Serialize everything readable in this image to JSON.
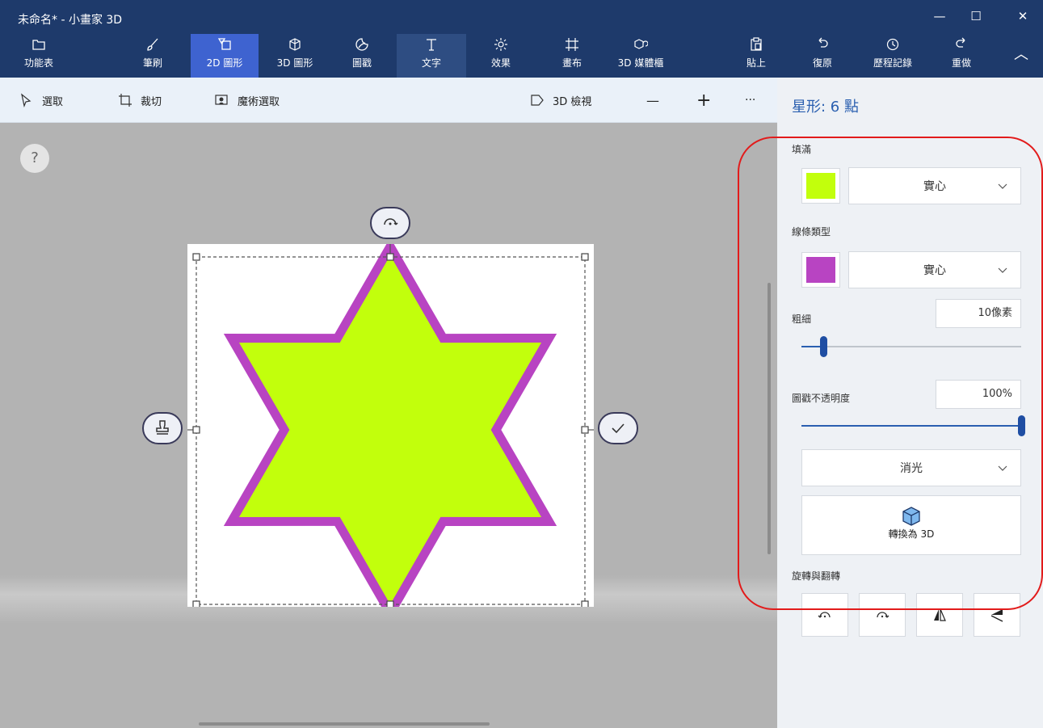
{
  "app": {
    "title": "未命名* - 小畫家 3D"
  },
  "window_controls": {
    "minimize": "—",
    "maximize": "☐",
    "close": "✕"
  },
  "ribbon": {
    "menu": "功能表",
    "tools": [
      {
        "label": "筆刷",
        "icon": "brush-icon"
      },
      {
        "label": "2D 圖形",
        "icon": "2d-shapes-icon"
      },
      {
        "label": "3D 圖形",
        "icon": "3d-shapes-icon"
      },
      {
        "label": "圖戳",
        "icon": "sticker-icon"
      },
      {
        "label": "文字",
        "icon": "text-icon"
      },
      {
        "label": "效果",
        "icon": "effects-icon"
      },
      {
        "label": "畫布",
        "icon": "canvas-icon"
      },
      {
        "label": "3D 媒體櫃",
        "icon": "3d-library-icon"
      },
      {
        "label": "貼上",
        "icon": "paste-icon"
      },
      {
        "label": "復原",
        "icon": "undo-icon"
      },
      {
        "label": "歷程記錄",
        "icon": "history-icon"
      },
      {
        "label": "重做",
        "icon": "redo-icon"
      }
    ],
    "active_tool": "2D 圖形",
    "collapse_glyph": "︿"
  },
  "toolbar2": {
    "select": "選取",
    "crop": "裁切",
    "magic_select": "魔術選取",
    "view_3d": "3D 檢視",
    "zoom_out": "—",
    "zoom_in": "+",
    "more": "···"
  },
  "canvas": {
    "help": "?",
    "shape": "six-point star",
    "fill_color": "#c2ff0c",
    "stroke_color": "#b844c2"
  },
  "panel": {
    "title": "星形: 6 點",
    "fill": {
      "label": "填滿",
      "color": "#c2ff0c",
      "type": "實心"
    },
    "line": {
      "label": "線條類型",
      "color": "#b844c2",
      "type": "實心"
    },
    "thickness": {
      "label": "粗細",
      "value": "10像素",
      "slider_fraction": 0.1
    },
    "opacity": {
      "label": "圖戳不透明度",
      "value": "100%",
      "slider_fraction": 1.0
    },
    "finish": "消光",
    "convert_3d": "轉換為 3D",
    "rotate_flip": {
      "label": "旋轉與翻轉"
    }
  },
  "colors": {
    "titlebar": "#1e3a6b",
    "active_tab": "#3e63d0",
    "accent": "#2a5fb0",
    "highlight_ring": "#e21b1b"
  }
}
